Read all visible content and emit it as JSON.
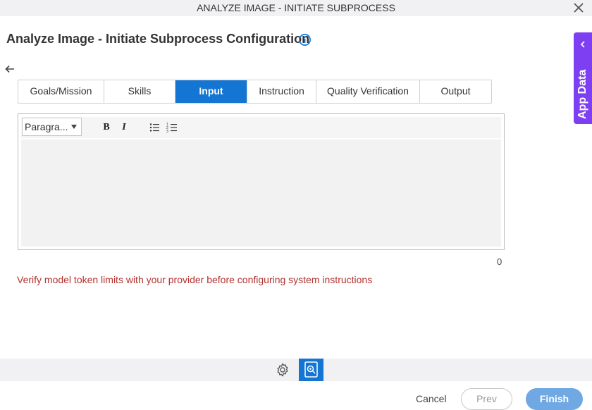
{
  "window": {
    "title": "ANALYZE IMAGE - INITIATE SUBPROCESS"
  },
  "page": {
    "title": "Analyze Image - Initiate Subprocess Configuration"
  },
  "app_data": {
    "label": "App Data"
  },
  "tabs": [
    {
      "label": "Goals/Mission",
      "active": false
    },
    {
      "label": "Skills",
      "active": false
    },
    {
      "label": "Input",
      "active": true
    },
    {
      "label": "Instruction",
      "active": false
    },
    {
      "label": "Quality Verification",
      "active": false
    },
    {
      "label": "Output",
      "active": false
    }
  ],
  "editor": {
    "format_value": "Paragra...",
    "bold_label": "B",
    "italic_label": "I",
    "content": "",
    "char_count": "0"
  },
  "warning": {
    "text": "Verify model token limits with your provider before configuring system instructions"
  },
  "footer": {
    "cancel": "Cancel",
    "prev": "Prev",
    "finish": "Finish"
  },
  "colors": {
    "accent": "#1476d2",
    "app_data": "#7e3ff2",
    "warning": "#b3322f",
    "finish": "#6fa8e3"
  },
  "icons": [
    "close-icon",
    "info-icon",
    "back-arrow-icon",
    "chevron-left-icon",
    "bullet-list-icon",
    "numbered-list-icon",
    "gear-icon",
    "ai-analyze-icon"
  ]
}
